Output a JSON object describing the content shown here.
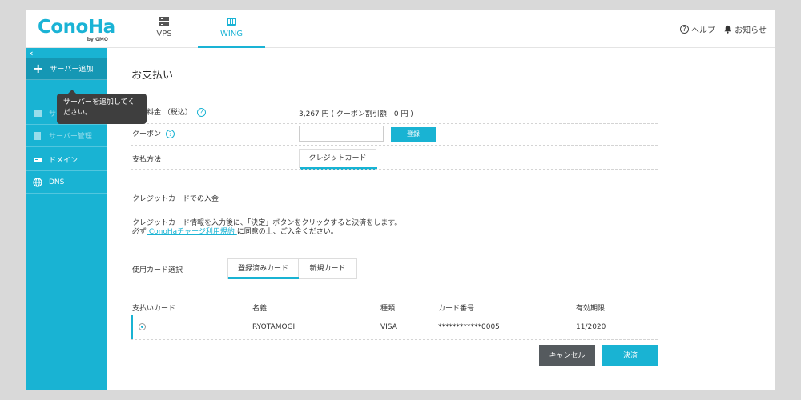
{
  "header": {
    "logo_text": "ConoHa",
    "logo_sub": "by GMO",
    "tabs": [
      {
        "label": "VPS"
      },
      {
        "label": "WING"
      }
    ],
    "help": "ヘルプ",
    "notice": "お知らせ"
  },
  "sidebar": {
    "collapse": "‹",
    "items": [
      {
        "label": "サーバー追加"
      },
      {
        "label": "サーバー管理"
      },
      {
        "label": "サーバー管理"
      },
      {
        "label": "ドメイン"
      },
      {
        "label": "DNS"
      }
    ],
    "tooltip": "サーバーを追加してください。"
  },
  "main": {
    "title": "お支払い",
    "fee_label": "申込料金 （税込）",
    "fee_value": "3,267 円 ( クーポン割引額　0 円 )",
    "coupon_label": "クーポン",
    "coupon_button": "登録",
    "pay_method_label": "支払方法",
    "pay_method_tab": "クレジットカード",
    "credit_heading": "クレジットカードでの入金",
    "instruction_line1": "クレジットカード情報を入力後に、「決定」ボタンをクリックすると決済をします。",
    "instruction_prefix": "必ず",
    "instruction_link": " ConoHaチャージ利用規約 ",
    "instruction_suffix": "に同意の上、ご入金ください。",
    "card_select_label": "使用カード選択",
    "card_tabs": [
      "登録済みカード",
      "新規カード"
    ],
    "table": {
      "headers": [
        "支払いカード",
        "名義",
        "種類",
        "カード番号",
        "有効期限"
      ],
      "row": {
        "name": "RYOTAMOGI",
        "type": "VISA",
        "number": "************0005",
        "expiry": "11/2020"
      }
    },
    "cancel": "キャンセル",
    "submit": "決済"
  }
}
